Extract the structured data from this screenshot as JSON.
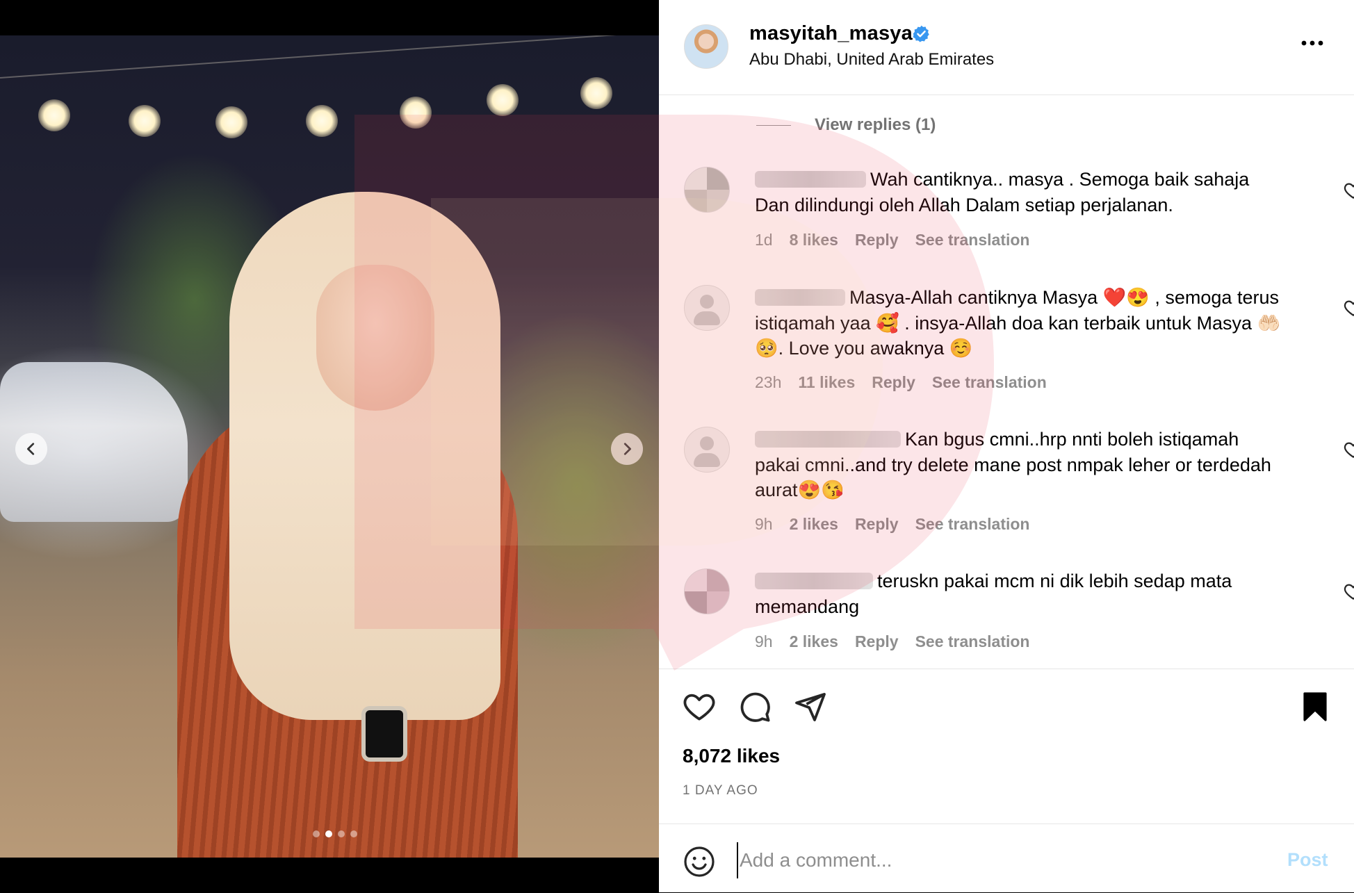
{
  "post": {
    "username": "masyitah_masya",
    "location": "Abu Dhabi, United Arab Emirates",
    "likes": "8,072 likes",
    "date": "1 DAY AGO",
    "carousel": {
      "current_index": 1,
      "total": 4
    }
  },
  "view_replies": {
    "label": "View replies (1)"
  },
  "comments": [
    {
      "text": "Wah cantiknya.. masya . Semoga baik sahaja Dan dilindungi oleh Allah Dalam setiap perjalanan.",
      "time": "1d",
      "likes": "8 likes",
      "reply": "Reply",
      "translate": "See translation"
    },
    {
      "text": "Masya-Allah cantiknya Masya ❤️😍 , semoga terus istiqamah yaa 🥰 . insya-Allah doa kan terbaik untuk Masya 🤲🏻🥺. Love you awaknya ☺️",
      "time": "23h",
      "likes": "11 likes",
      "reply": "Reply",
      "translate": "See translation"
    },
    {
      "text": "Kan bgus cmni..hrp nnti boleh istiqamah pakai cmni..and try delete mane post nmpak leher or terdedah aurat😍😘",
      "time": "9h",
      "likes": "2 likes",
      "reply": "Reply",
      "translate": "See translation"
    },
    {
      "text": "teruskn pakai mcm ni dik lebih sedap mata memandang",
      "time": "9h",
      "likes": "2 likes",
      "reply": "Reply",
      "translate": "See translation"
    }
  ],
  "comment_box": {
    "placeholder": "Add a comment...",
    "post_label": "Post"
  },
  "icons": {
    "verified": "verified-badge-icon",
    "more": "more-options-icon",
    "like": "heart-icon",
    "comment": "comment-icon",
    "share": "share-icon",
    "save": "bookmark-icon",
    "emoji": "emoji-icon",
    "prev": "chevron-left-icon",
    "next": "chevron-right-icon"
  },
  "colors": {
    "verified": "#3897f0",
    "post_button": "#b2dffc",
    "muted": "#8e8e8e",
    "watermark": "#e8394d"
  }
}
